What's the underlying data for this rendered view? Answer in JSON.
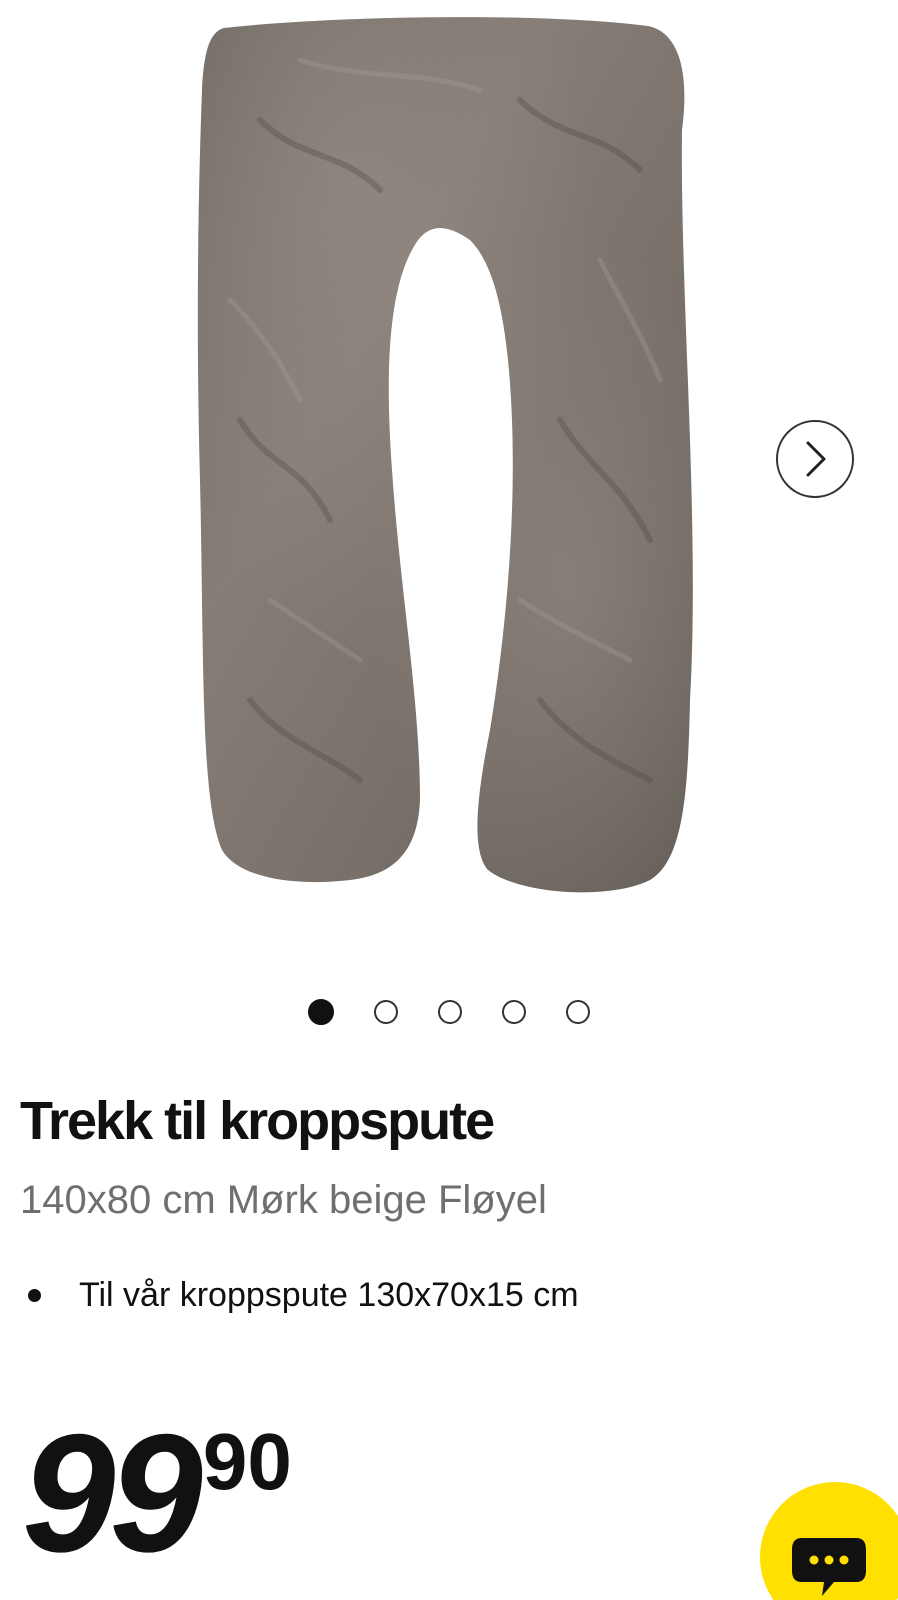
{
  "gallery": {
    "product_image_alt": "",
    "slide_count": 5,
    "active_slide": 1,
    "next_icon": "chevron-right-icon"
  },
  "product": {
    "title": "Trekk til kroppspute",
    "subtitle": "140x80 cm Mørk beige Fløyel",
    "features": [
      "Til vår kroppspute 130x70x15 cm"
    ]
  },
  "price": {
    "main": "99",
    "cents": "90"
  },
  "chat": {
    "icon": "chat-bubble-icon"
  },
  "colors": {
    "chat_accent": "#ffe000",
    "pillow": "#7b736c"
  }
}
